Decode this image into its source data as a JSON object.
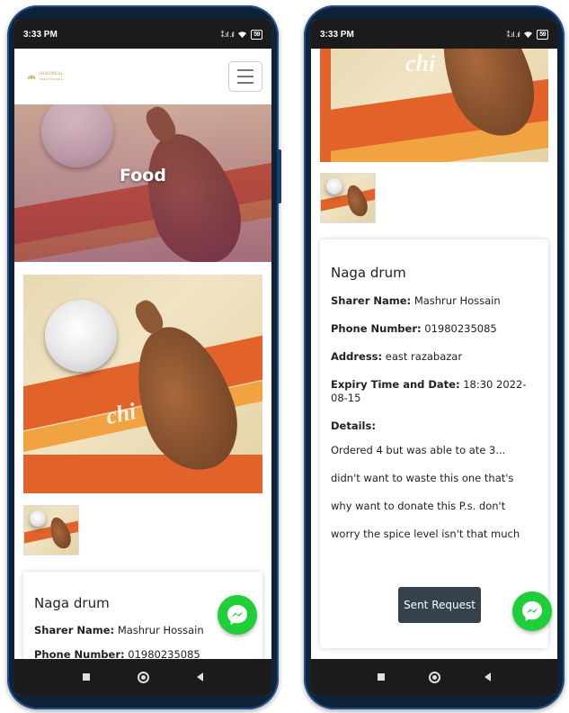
{
  "status_bar": {
    "time": "3:33 PM",
    "signal": "⁑.ıl .ıl",
    "battery": "59"
  },
  "navbar": {
    "logo_line1": "SHARMEAL",
    "logo_line2": "SHARE YOUR MEAL"
  },
  "hero": {
    "title": "Food"
  },
  "photo": {
    "watermark": "chi"
  },
  "item": {
    "name": "Naga drum",
    "sharer_label": "Sharer Name:",
    "sharer_value": "Mashrur Hossain",
    "phone_label": "Phone Number:",
    "phone_value": "01980235085",
    "address_label": "Address:",
    "address_value": "east razabazar",
    "expiry_label": "Expiry Time and Date:",
    "expiry_value": "18:30 2022-08-15",
    "details_label": "Details:",
    "details_value": "Ordered 4 but was able to ate 3... didn't want to waste this one that's why want to donate this P.s. don't worry the spice level isn't that much"
  },
  "actions": {
    "request_button": "Sent Request"
  },
  "colors": {
    "accent_green": "#1fcf3a",
    "button_dark": "#36424b",
    "status_bar": "#1b1b1b"
  },
  "icons": {
    "messenger": "messenger-icon",
    "menu": "hamburger-icon"
  }
}
